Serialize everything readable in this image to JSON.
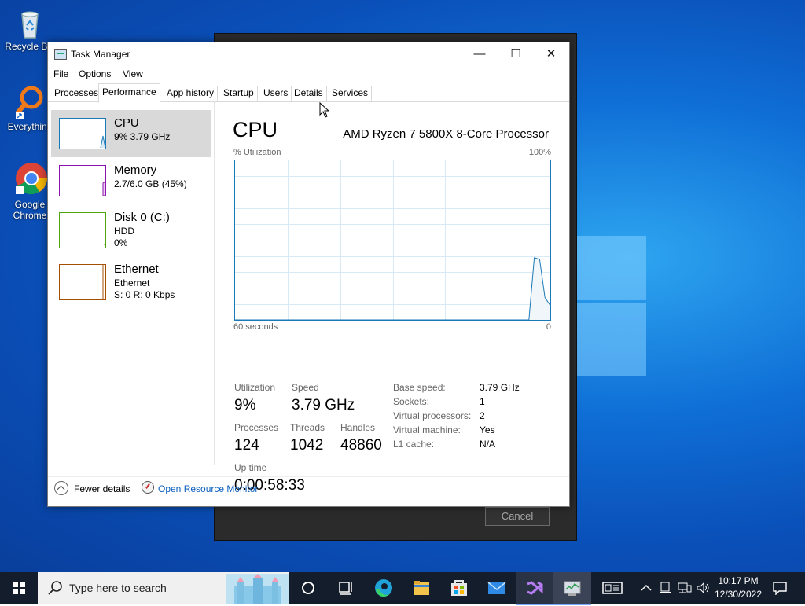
{
  "desktop": {
    "icons": [
      {
        "name": "recycle-bin",
        "label": "Recycle Bin"
      },
      {
        "name": "everything",
        "label": "Everything"
      },
      {
        "name": "google-chrome",
        "label": "Google Chrome"
      }
    ]
  },
  "back_dialog": {
    "cancel_label": "Cancel"
  },
  "taskmgr": {
    "title": "Task Manager",
    "caption_buttons": {
      "minimize": "—",
      "maximize": "☐",
      "close": "✕"
    },
    "menu": [
      "File",
      "Options",
      "View"
    ],
    "tabs": [
      "Processes",
      "Performance",
      "App history",
      "Startup",
      "Users",
      "Details",
      "Services"
    ],
    "active_tab": "Performance",
    "resources": [
      {
        "name": "CPU",
        "line1": "9% 3.79 GHz",
        "line2": "",
        "color": "#1a7ab7"
      },
      {
        "name": "Memory",
        "line1": "2.7/6.0 GB (45%)",
        "line2": "",
        "color": "#8b12ae"
      },
      {
        "name": "Disk 0 (C:)",
        "line1": "HDD",
        "line2": "0%",
        "color": "#4da60c"
      },
      {
        "name": "Ethernet",
        "line1": "Ethernet",
        "line2": "S: 0 R: 0 Kbps",
        "color": "#a74f01"
      }
    ],
    "cpu": {
      "title": "CPU",
      "model": "AMD Ryzen 7 5800X 8-Core Processor",
      "graph_label_left": "% Utilization",
      "graph_label_right": "100%",
      "axis_left": "60 seconds",
      "axis_right": "0",
      "utilization_samples": [
        0,
        0,
        0,
        0,
        0,
        0,
        0,
        0,
        0,
        0,
        0,
        0,
        0,
        0,
        0,
        0,
        0,
        0,
        0,
        0,
        0,
        0,
        0,
        0,
        0,
        0,
        0,
        0,
        0,
        0,
        0,
        0,
        0,
        0,
        0,
        0,
        0,
        0,
        0,
        0,
        0,
        0,
        0,
        0,
        0,
        0,
        0,
        0,
        0,
        0,
        0,
        0,
        0,
        0,
        0,
        0,
        39,
        38,
        14,
        9
      ],
      "stats": {
        "utilization_label": "Utilization",
        "utilization": "9%",
        "speed_label": "Speed",
        "speed": "3.79 GHz",
        "processes_label": "Processes",
        "processes": "124",
        "threads_label": "Threads",
        "threads": "1042",
        "handles_label": "Handles",
        "handles": "48860",
        "uptime_label": "Up time",
        "uptime": "0:00:58:33"
      },
      "details": [
        {
          "label": "Base speed:",
          "value": "3.79 GHz"
        },
        {
          "label": "Sockets:",
          "value": "1"
        },
        {
          "label": "Virtual processors:",
          "value": "2"
        },
        {
          "label": "Virtual machine:",
          "value": "Yes"
        },
        {
          "label": "L1 cache:",
          "value": "N/A"
        }
      ]
    },
    "bottom": {
      "fewer_details": "Fewer details",
      "open_resource_monitor": "Open Resource Monitor"
    }
  },
  "taskbar": {
    "search_placeholder": "Type here to search",
    "time": "10:17 PM",
    "date": "12/30/2022"
  }
}
